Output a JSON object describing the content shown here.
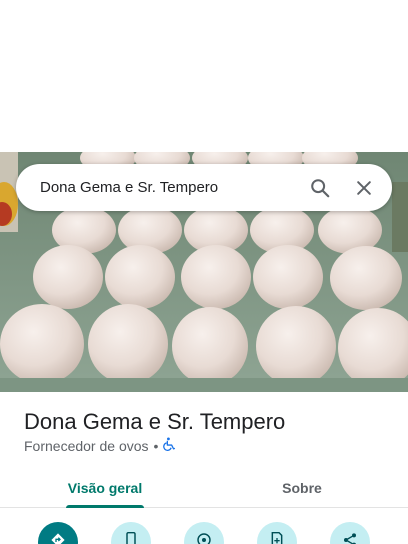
{
  "search": {
    "query": "Dona Gema e Sr. Tempero",
    "search_icon": "search-icon",
    "close_icon": "close-icon"
  },
  "photo": {
    "subject": "eggs-in-tray-photo"
  },
  "place": {
    "title": "Dona Gema e Sr. Tempero",
    "category": "Fornecedor de ovos",
    "separator": "•",
    "accessibility_icon": "wheelchair-icon"
  },
  "tabs": [
    {
      "label": "Visão geral",
      "selected": true
    },
    {
      "label": "Sobre",
      "selected": false
    }
  ],
  "actions": [
    {
      "icon": "directions-icon"
    },
    {
      "icon": "phone-icon"
    },
    {
      "icon": "radar-icon"
    },
    {
      "icon": "save-icon"
    },
    {
      "icon": "share-icon"
    }
  ],
  "colors": {
    "accent": "#00796b",
    "action_primary": "#007b83",
    "action_bg": "#c4eef2",
    "text_primary": "#202124",
    "text_secondary": "#5f6368",
    "accessibility_blue": "#1a73e8"
  }
}
